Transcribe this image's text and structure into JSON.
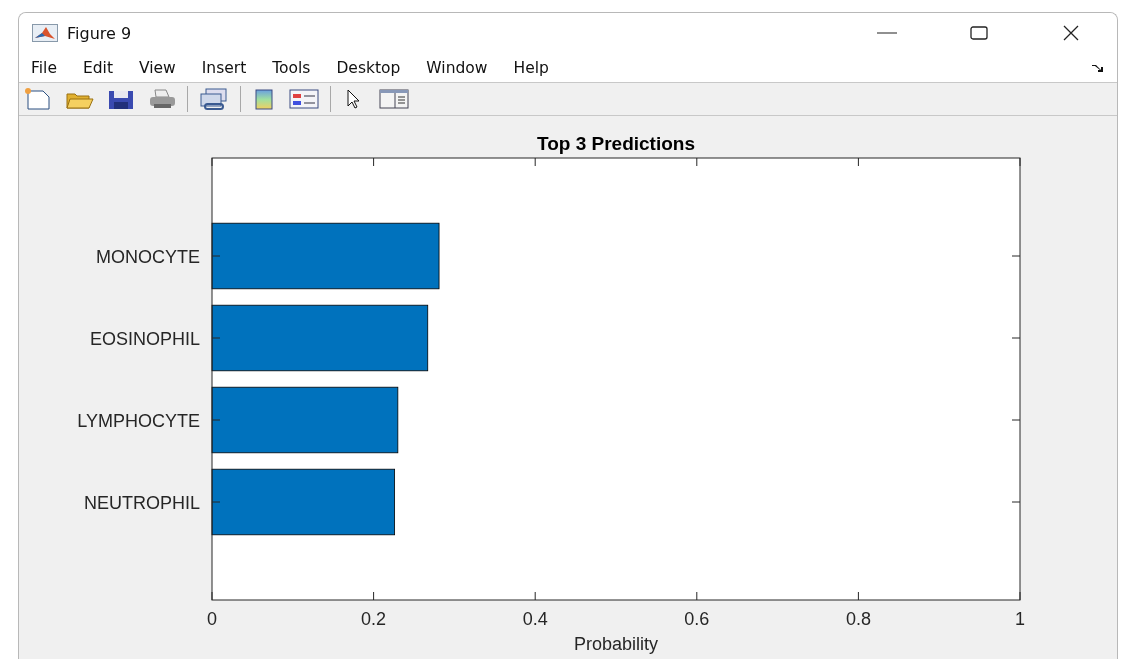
{
  "window": {
    "title": "Figure 9"
  },
  "menu": [
    "File",
    "Edit",
    "View",
    "Insert",
    "Tools",
    "Desktop",
    "Window",
    "Help"
  ],
  "chart_data": {
    "type": "bar",
    "orientation": "horizontal",
    "title": "Top 3 Predictions",
    "xlabel": "Probability",
    "categories": [
      "MONOCYTE",
      "EOSINOPHIL",
      "LYMPHOCYTE",
      "NEUTROPHIL"
    ],
    "series": [
      {
        "color": "#0072bd",
        "values": [
          0.281,
          0.267,
          0.23,
          0.226
        ]
      }
    ],
    "xlim": [
      0,
      1
    ],
    "xticks": [
      {
        "value": 0,
        "label": "0"
      },
      {
        "value": 0.2,
        "label": "0.2"
      },
      {
        "value": 0.4,
        "label": "0.4"
      },
      {
        "value": 0.6,
        "label": "0.6"
      },
      {
        "value": 0.8,
        "label": "0.8"
      },
      {
        "value": 1,
        "label": "1"
      }
    ]
  }
}
